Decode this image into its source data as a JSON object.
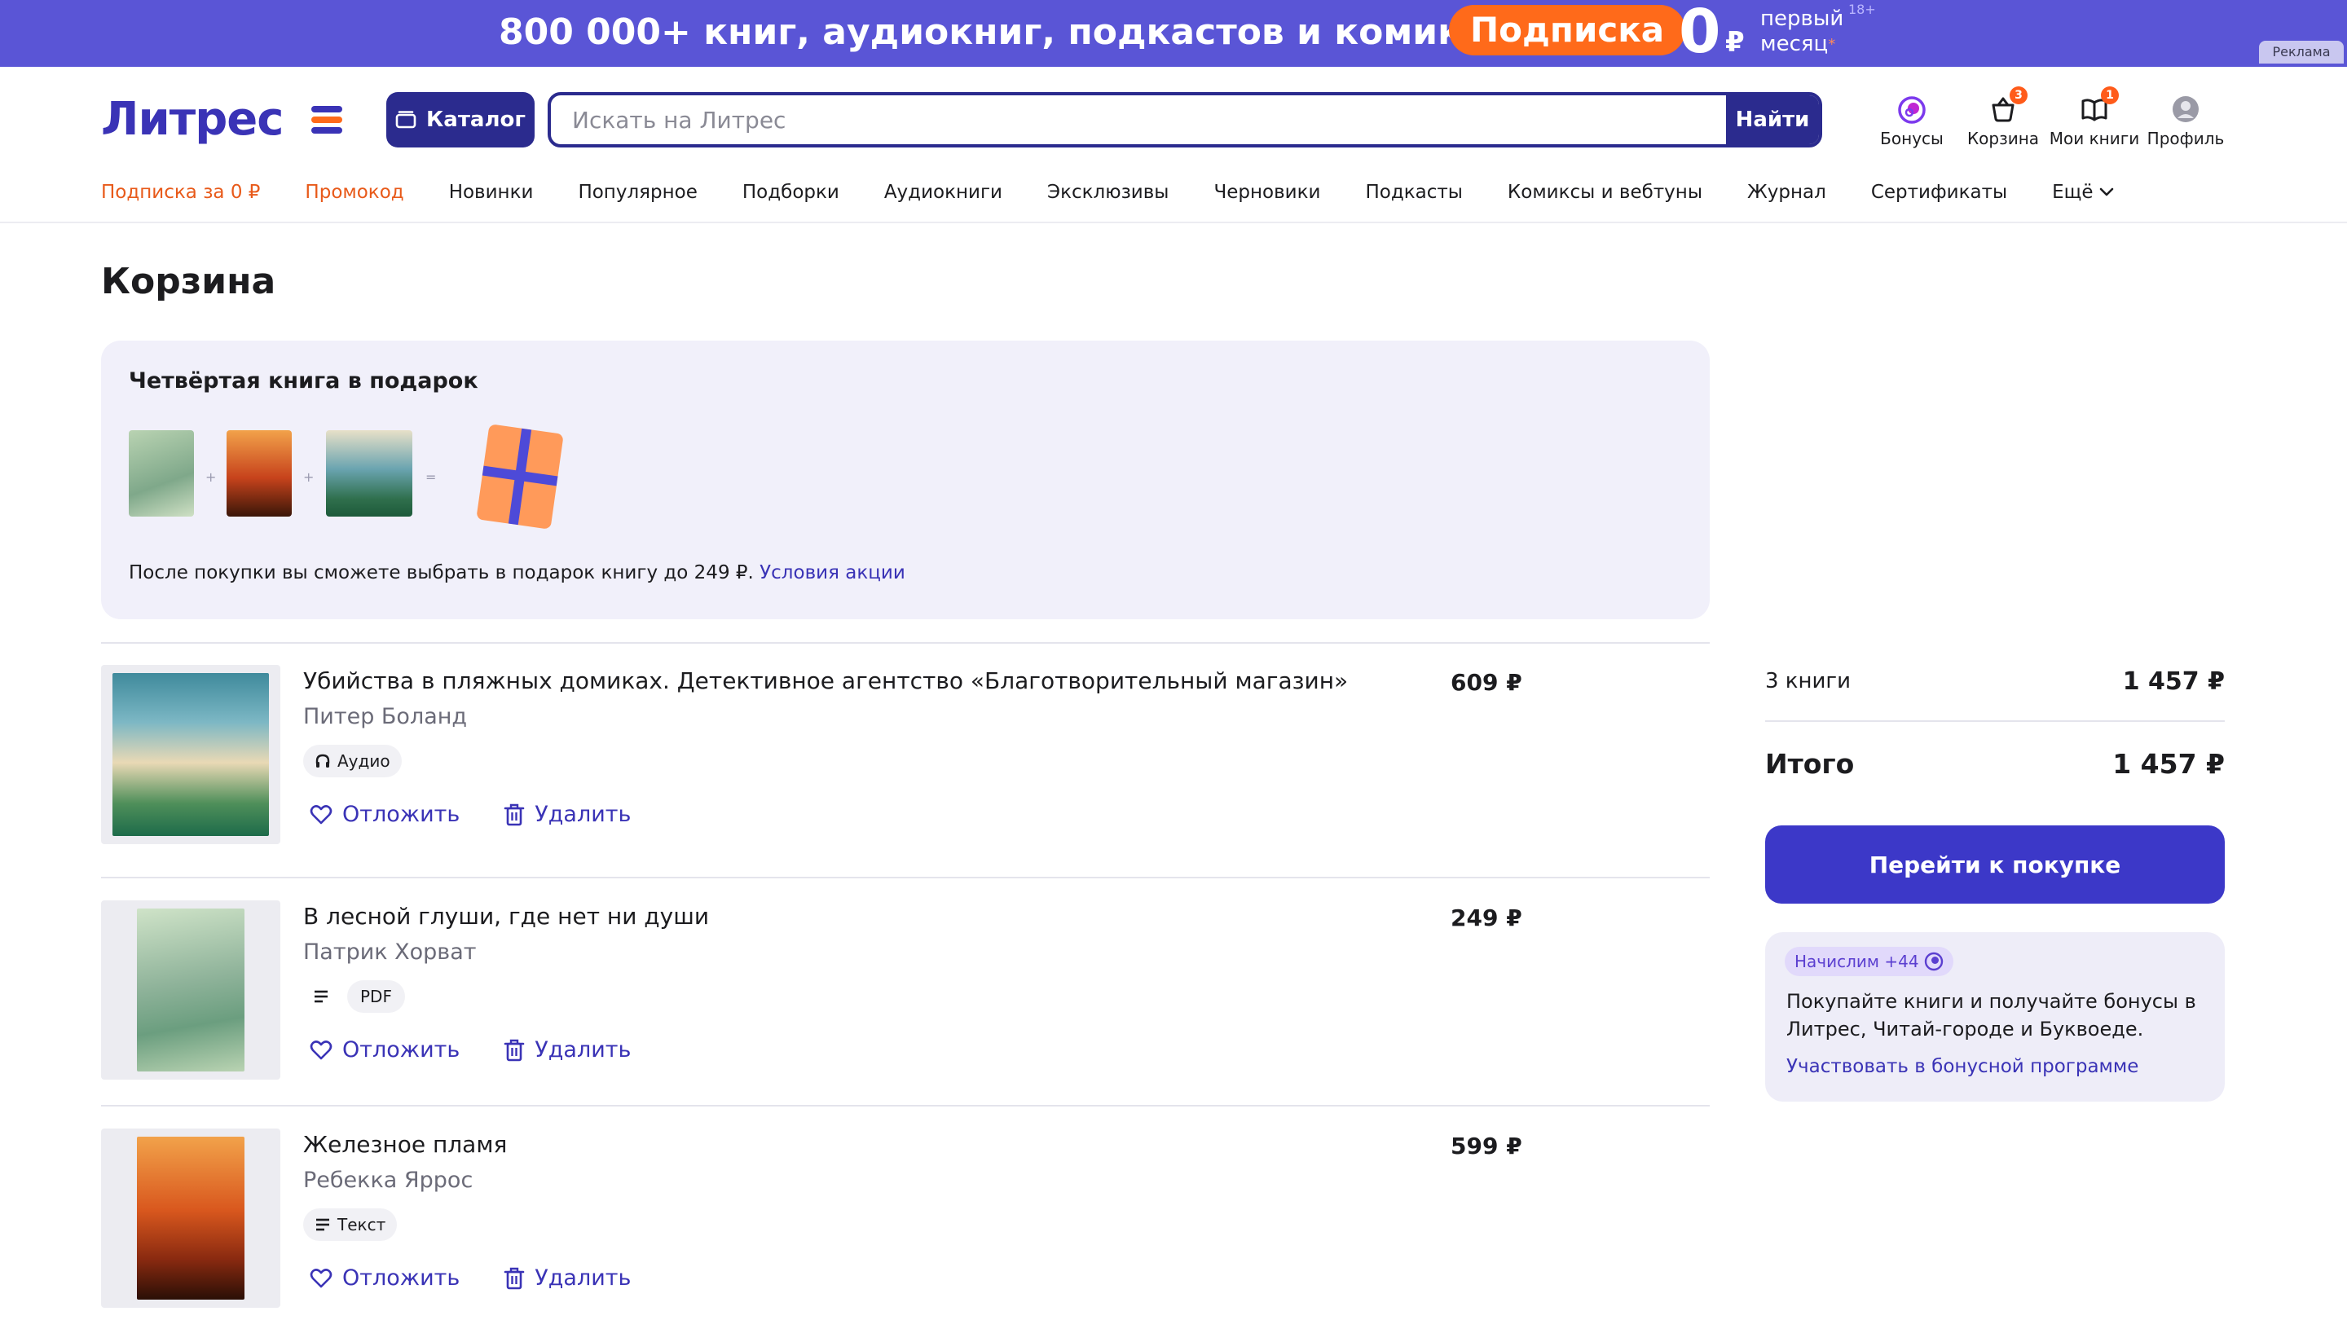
{
  "banner": {
    "text": "800 000+ книг, аудиокниг, подкастов и комиксов",
    "pill": "Подписка",
    "price_zero": "0",
    "price_currency": "₽",
    "price_note_line1": "первый",
    "price_note_line2": "месяц",
    "price_note_mark": "*",
    "age": "18+",
    "ad_label": "Реклама",
    "bg_color": "#5a55d6",
    "pill_color": "#ff6a1a"
  },
  "header": {
    "logo": "Литрес",
    "catalog_label": "Каталог",
    "search_placeholder": "Искать на Литрес",
    "search_button": "Найти",
    "icons": [
      {
        "label": "Бонусы",
        "icon": "bonus-icon"
      },
      {
        "label": "Корзина",
        "icon": "cart-icon",
        "badge": "3"
      },
      {
        "label": "Мои книги",
        "icon": "my-books-icon",
        "badge": "1"
      },
      {
        "label": "Профиль",
        "icon": "profile-icon"
      }
    ]
  },
  "nav": {
    "items": [
      "Подписка за 0 ₽",
      "Промокод",
      "Новинки",
      "Популярное",
      "Подборки",
      "Аудиокниги",
      "Эксклюзивы",
      "Черновики",
      "Подкасты",
      "Комиксы и вебтуны",
      "Журнал",
      "Сертификаты",
      "Ещё"
    ],
    "accent_color": "#e85a1a"
  },
  "page": {
    "title": "Корзина"
  },
  "promo": {
    "title": "Четвёртая книга в подарок",
    "plus": "+",
    "equals": "=",
    "note": "После покупки вы сможете выбрать в подарок книгу до 249 ₽.",
    "link": "Условия акции"
  },
  "cart": {
    "items": [
      {
        "title": "Убийства в пляжных домиках. Детективное агентство «Благотворительный магазин»",
        "author": "Питер Боланд",
        "format": "Аудио",
        "format_icon": "headphones-icon",
        "price": "609 ₽",
        "save_label": "Отложить",
        "delete_label": "Удалить"
      },
      {
        "title": "В лесной глуши, где нет ни души",
        "author": "Патрик Хорват",
        "format": "PDF",
        "format_icon": "text-lines-icon",
        "price": "249 ₽",
        "save_label": "Отложить",
        "delete_label": "Удалить"
      },
      {
        "title": "Железное пламя",
        "author": "Ребекка Яррос",
        "format": "Текст",
        "format_icon": "text-lines-icon",
        "price": "599 ₽",
        "save_label": "Отложить",
        "delete_label": "Удалить"
      }
    ]
  },
  "summary": {
    "count_label": "3 книги",
    "count_value": "1 457 ₽",
    "total_label": "Итого",
    "total_value": "1 457 ₽",
    "buy_button": "Перейти к покупке",
    "bonus_chip": "Начислим +44",
    "bonus_text": "Покупайте книги и получайте бонусы в Литрес, Читай-городе и Буквоеде.",
    "bonus_link": "Участвовать в бонусной программе"
  }
}
